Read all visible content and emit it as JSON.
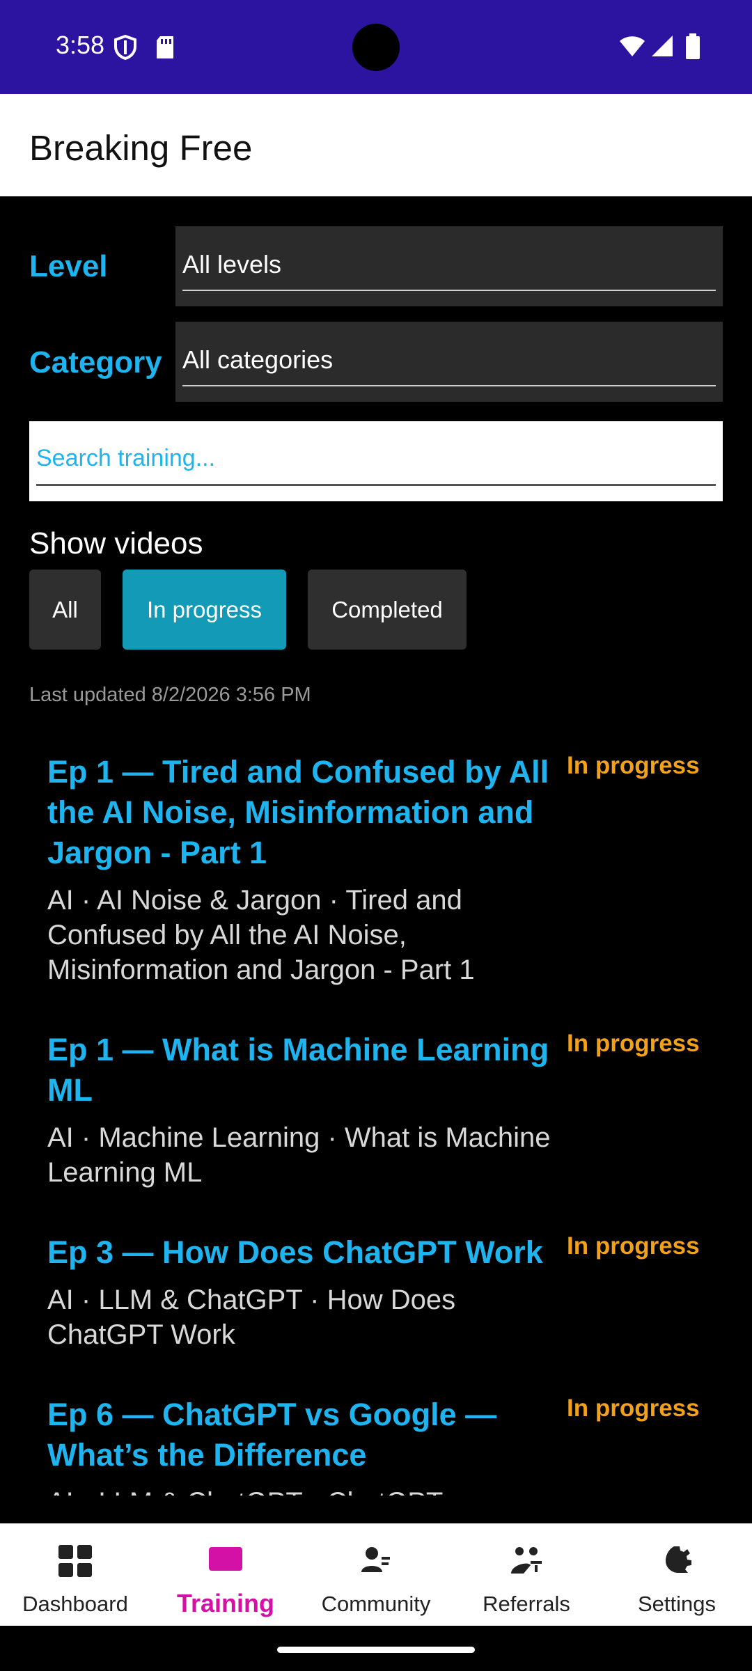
{
  "status_bar": {
    "time": "3:58"
  },
  "app_bar": {
    "title": "Breaking Free"
  },
  "filters": {
    "level_label": "Level",
    "level_value": "All levels",
    "category_label": "Category",
    "category_value": "All categories"
  },
  "search": {
    "placeholder": "Search training..."
  },
  "show_videos": {
    "title": "Show videos",
    "options": [
      {
        "label": "All",
        "active": false
      },
      {
        "label": "In progress",
        "active": true
      },
      {
        "label": "Completed",
        "active": false
      }
    ]
  },
  "last_updated": "Last updated 8/2/2026 3:56 PM",
  "trainings": [
    {
      "title": "Ep 1 — Tired and Confused by All the AI Noise, Misinformation and Jargon - Part 1",
      "status": "In progress",
      "description": "AI · AI Noise & Jargon · Tired and Confused by All the AI Noise, Misinformation and Jargon - Part 1"
    },
    {
      "title": "Ep 1 — What is Machine Learning ML",
      "status": "In progress",
      "description": "AI · Machine Learning · What is Machine Learning ML"
    },
    {
      "title": "Ep 3 — How Does ChatGPT Work",
      "status": "In progress",
      "description": "AI · LLM & ChatGPT · How Does ChatGPT Work"
    },
    {
      "title": "Ep 6 — ChatGPT vs Google — What’s the Difference",
      "status": "In progress",
      "description": "AI · LLM & ChatGPT · ChatGPT vs Google — What’s the Difference"
    }
  ],
  "bottom_nav": [
    {
      "label": "Dashboard",
      "icon": "dashboard-icon"
    },
    {
      "label": "Training",
      "icon": "training-icon",
      "active": true
    },
    {
      "label": "Community",
      "icon": "community-icon"
    },
    {
      "label": "Referrals",
      "icon": "referrals-icon"
    },
    {
      "label": "Settings",
      "icon": "settings-icon"
    }
  ],
  "colors": {
    "status_bar": "#2c13a0",
    "accent_blue": "#1eb4f0",
    "status_orange": "#f2a11c",
    "active_chip": "#139ab6",
    "nav_active": "#d411a6"
  }
}
